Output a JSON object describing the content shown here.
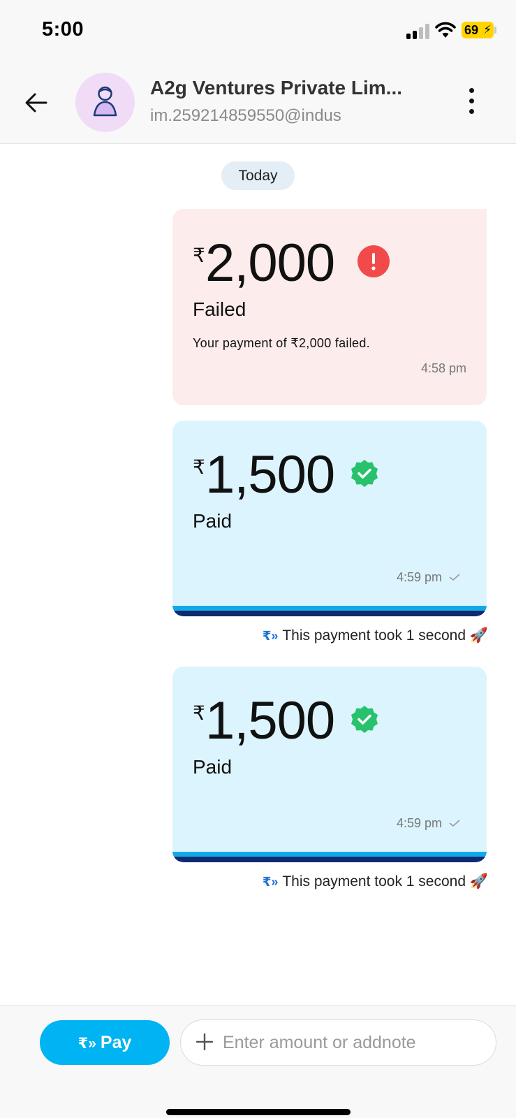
{
  "status_bar": {
    "time": "5:00",
    "battery": "69"
  },
  "header": {
    "contact_name": "A2g Ventures Private Lim...",
    "contact_upi": "im.259214859550@indus"
  },
  "chat": {
    "date_label": "Today",
    "payments": [
      {
        "currency": "₹",
        "amount": "2,000",
        "status": "Failed",
        "description": "Your payment of ₹2,000 failed.",
        "time": "4:58 pm",
        "status_color": "#f24a4a"
      },
      {
        "currency": "₹",
        "amount": "1,500",
        "status": "Paid",
        "time": "4:59 pm",
        "speed_note": "This payment took 1 second 🚀",
        "status_color": "#27c26b"
      },
      {
        "currency": "₹",
        "amount": "1,500",
        "status": "Paid",
        "time": "4:59 pm",
        "speed_note": "This payment took 1 second 🚀",
        "status_color": "#27c26b"
      }
    ]
  },
  "composer": {
    "pay_label": "Pay",
    "input_placeholder": "Enter amount or addnote"
  },
  "colors": {
    "accent": "#00b3f2",
    "failed_bg": "#fdecec",
    "paid_bg": "#dcf4fd"
  }
}
